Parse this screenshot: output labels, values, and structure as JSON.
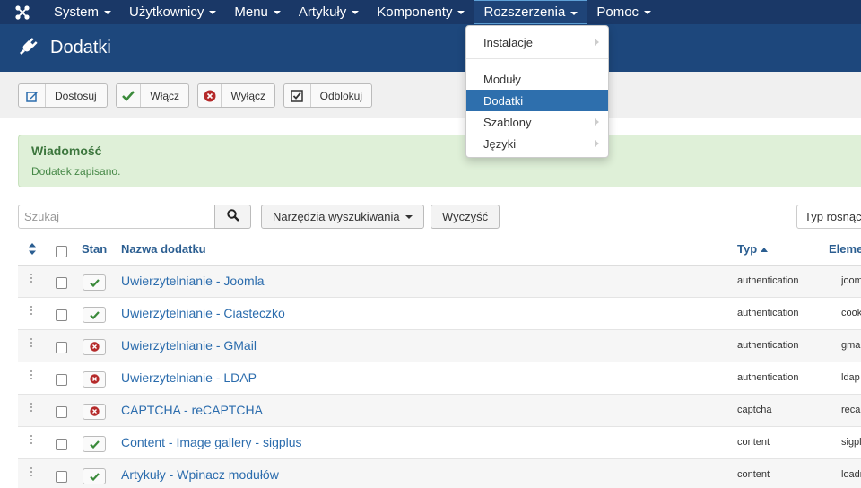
{
  "nav": {
    "logo_icon": "joomla-icon",
    "items": [
      {
        "label": "System"
      },
      {
        "label": "Użytkownicy"
      },
      {
        "label": "Menu"
      },
      {
        "label": "Artykuły"
      },
      {
        "label": "Komponenty"
      },
      {
        "label": "Rozszerzenia"
      },
      {
        "label": "Pomoc"
      }
    ],
    "active_index": 5
  },
  "header": {
    "icon": "plug-icon",
    "title": "Dodatki"
  },
  "toolbar": {
    "buttons": [
      {
        "label": "Dostosuj",
        "icon": "edit-icon"
      },
      {
        "label": "Włącz",
        "icon": "check-icon"
      },
      {
        "label": "Wyłącz",
        "icon": "disable-icon"
      },
      {
        "label": "Odblokuj",
        "icon": "checkin-icon"
      }
    ]
  },
  "message": {
    "title": "Wiadomość",
    "text": "Dodatek zapisano."
  },
  "search": {
    "placeholder": "Szukaj",
    "tools_label": "Narzędzia wyszukiwania",
    "clear_label": "Wyczyść",
    "sort_label": "Typ rosnąco"
  },
  "table": {
    "headers": {
      "state": "Stan",
      "name": "Nazwa dodatku",
      "type": "Typ",
      "element": "Element"
    },
    "rows": [
      {
        "name": "Uwierzytelnianie - Joomla",
        "type": "authentication",
        "element": "joomla",
        "enabled": true
      },
      {
        "name": "Uwierzytelnianie - Ciasteczko",
        "type": "authentication",
        "element": "cookie",
        "enabled": true
      },
      {
        "name": "Uwierzytelnianie - GMail",
        "type": "authentication",
        "element": "gmail",
        "enabled": false
      },
      {
        "name": "Uwierzytelnianie - LDAP",
        "type": "authentication",
        "element": "ldap",
        "enabled": false
      },
      {
        "name": "CAPTCHA - reCAPTCHA",
        "type": "captcha",
        "element": "recaptcha",
        "enabled": false
      },
      {
        "name": "Content - Image gallery - sigplus",
        "type": "content",
        "element": "sigplus",
        "enabled": true
      },
      {
        "name": "Artykuły - Wpinacz modułów",
        "type": "content",
        "element": "loadmodule",
        "enabled": true
      }
    ]
  },
  "dropdown": {
    "items": [
      {
        "label": "Instalacje",
        "submenu": true
      },
      {
        "label": "Moduły",
        "submenu": false
      },
      {
        "label": "Dodatki",
        "submenu": false
      },
      {
        "label": "Szablony",
        "submenu": true
      },
      {
        "label": "Języki",
        "submenu": true
      }
    ],
    "active_index": 2
  },
  "colors": {
    "nav_bg": "#1a3867",
    "header_bg": "#1d477c",
    "link": "#2b6cad",
    "enabled": "#3a8a3a",
    "disabled": "#b52a2a"
  }
}
